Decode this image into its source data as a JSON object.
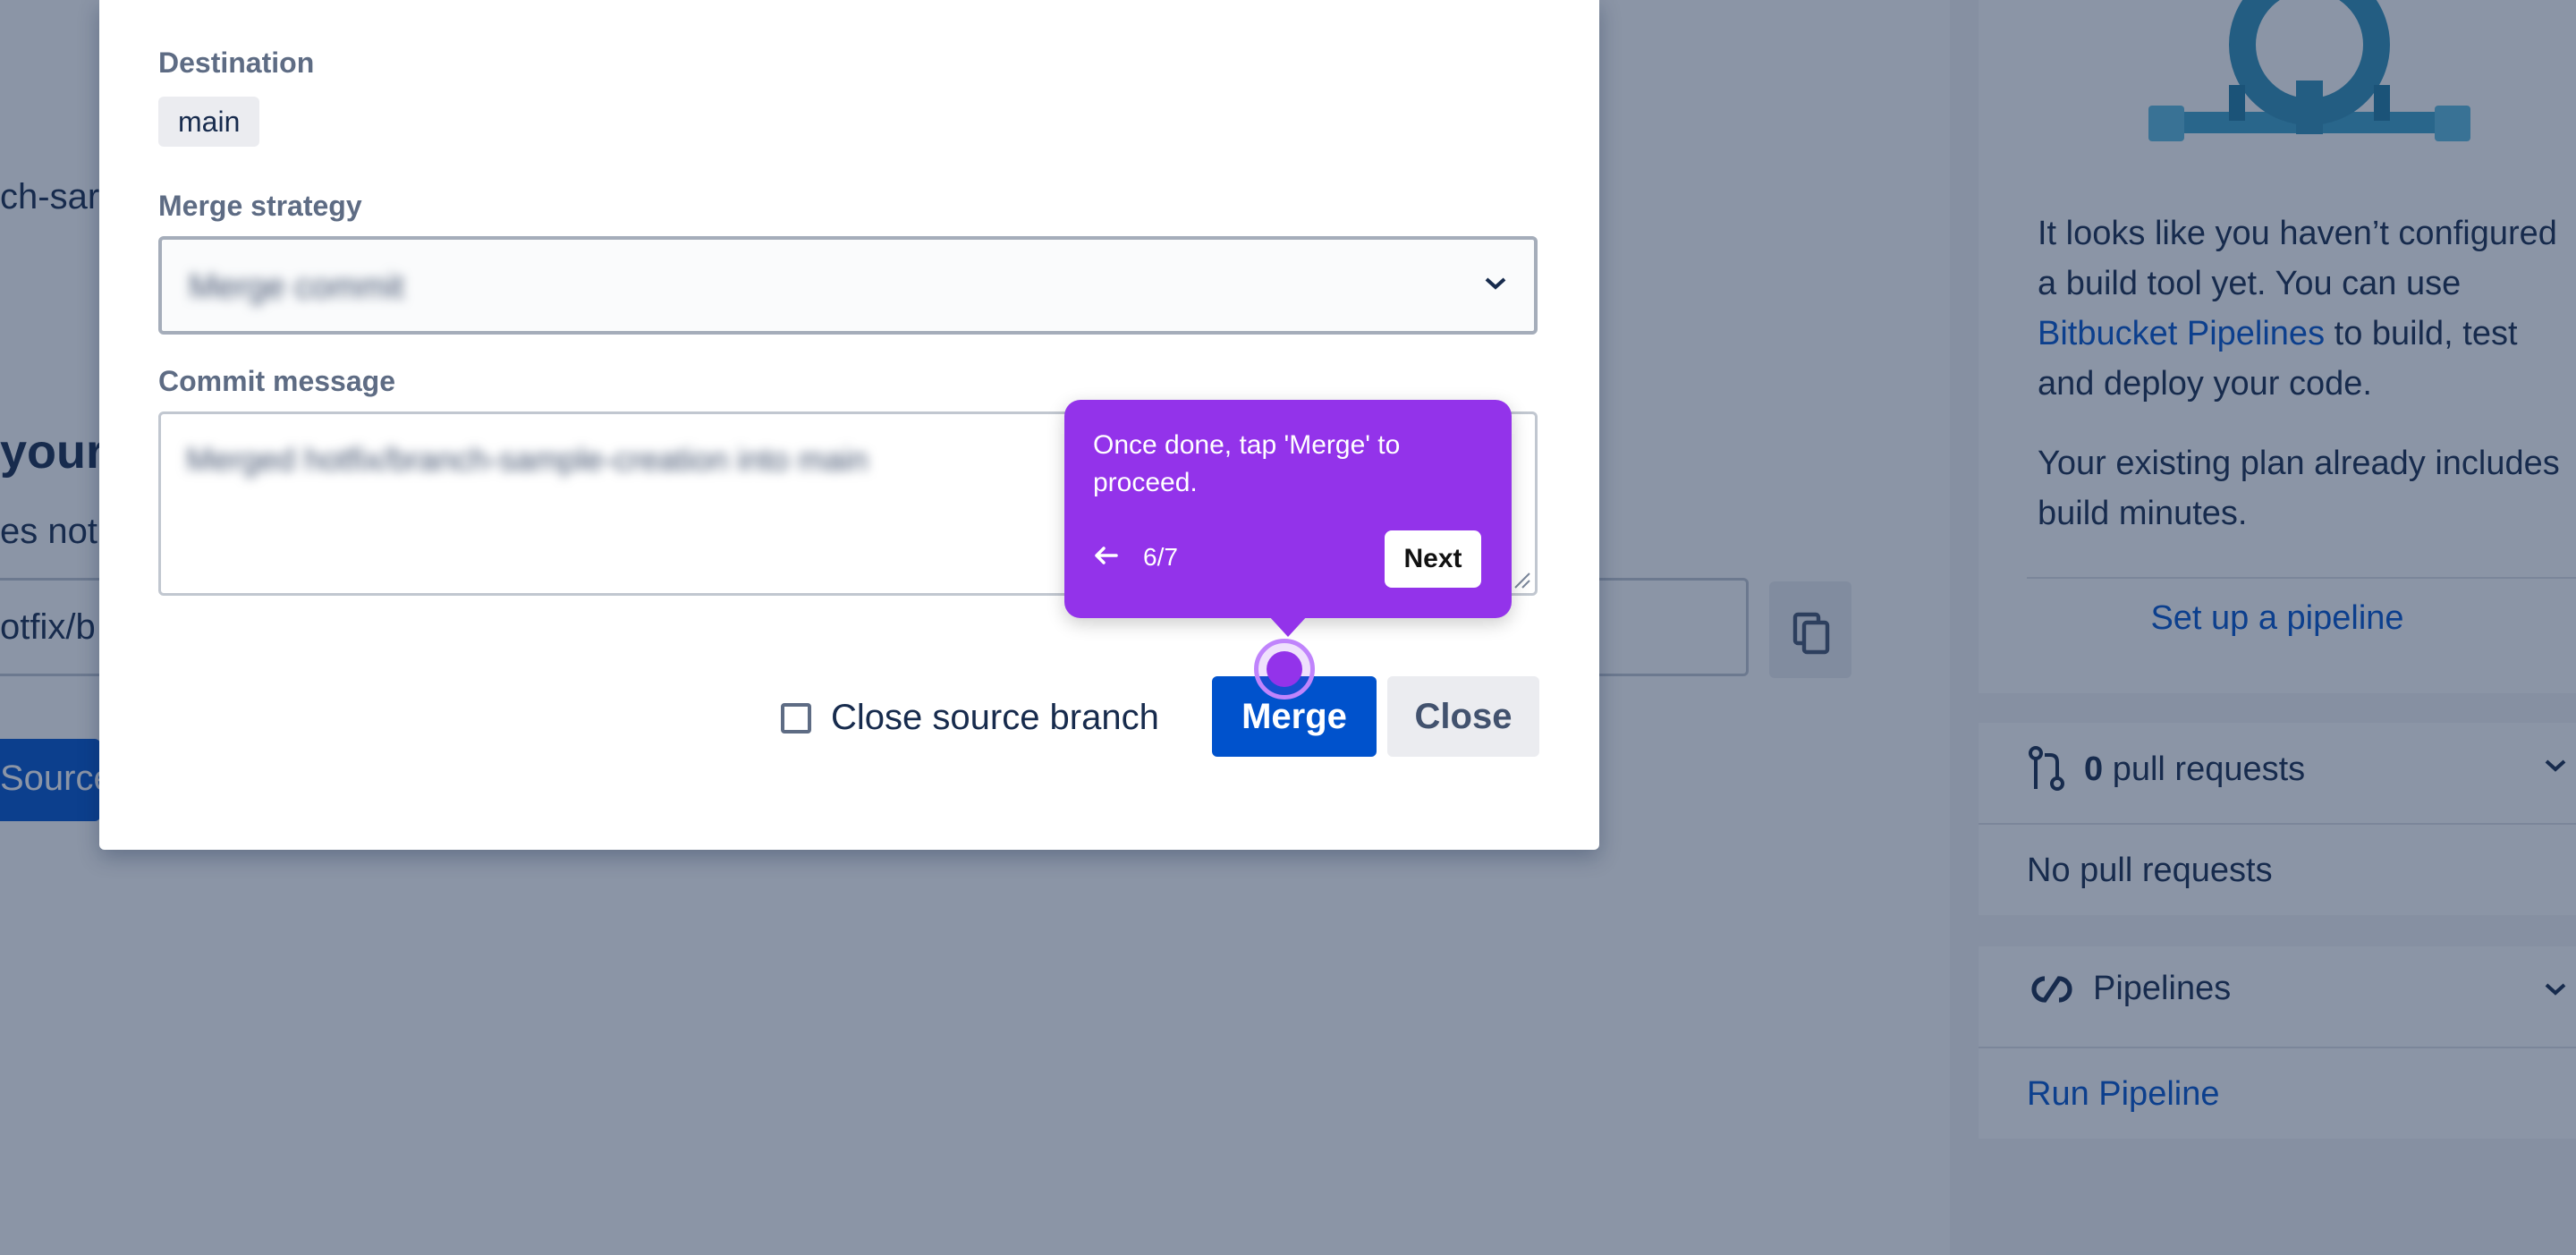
{
  "background": {
    "fragments": {
      "branch_name": "ch-sar",
      "heading": "your b",
      "subtext": "es not",
      "input_value": "otfix/b",
      "source_button": "Source"
    },
    "sidebar": {
      "build_text_1": "It looks like you haven’t configured a build tool yet. You can use ",
      "build_link": "Bitbucket Pipelines",
      "build_text_2": " to build, test and deploy your code.",
      "plan_text": "Your existing plan already includes build minutes.",
      "setup_link": "Set up a pipeline",
      "pr_count": "0",
      "pr_label": "pull requests",
      "pr_empty": "No pull requests",
      "pipelines_label": "Pipelines",
      "run_pipeline": "Run Pipeline"
    }
  },
  "modal": {
    "destination_label": "Destination",
    "destination_value": "main",
    "strategy_label": "Merge strategy",
    "strategy_value": "Merge commit",
    "commit_label": "Commit message",
    "commit_value": "Merged hotfix/branch-sample-creation into main",
    "close_source_label": "Close source branch",
    "merge_button": "Merge",
    "close_button": "Close"
  },
  "tooltip": {
    "message": "Once done, tap 'Merge' to proceed.",
    "step": "6/7",
    "next_button": "Next"
  },
  "colors": {
    "overlay": "#172b4d",
    "primary": "#0052cc",
    "guide_purple": "#9333ea"
  }
}
